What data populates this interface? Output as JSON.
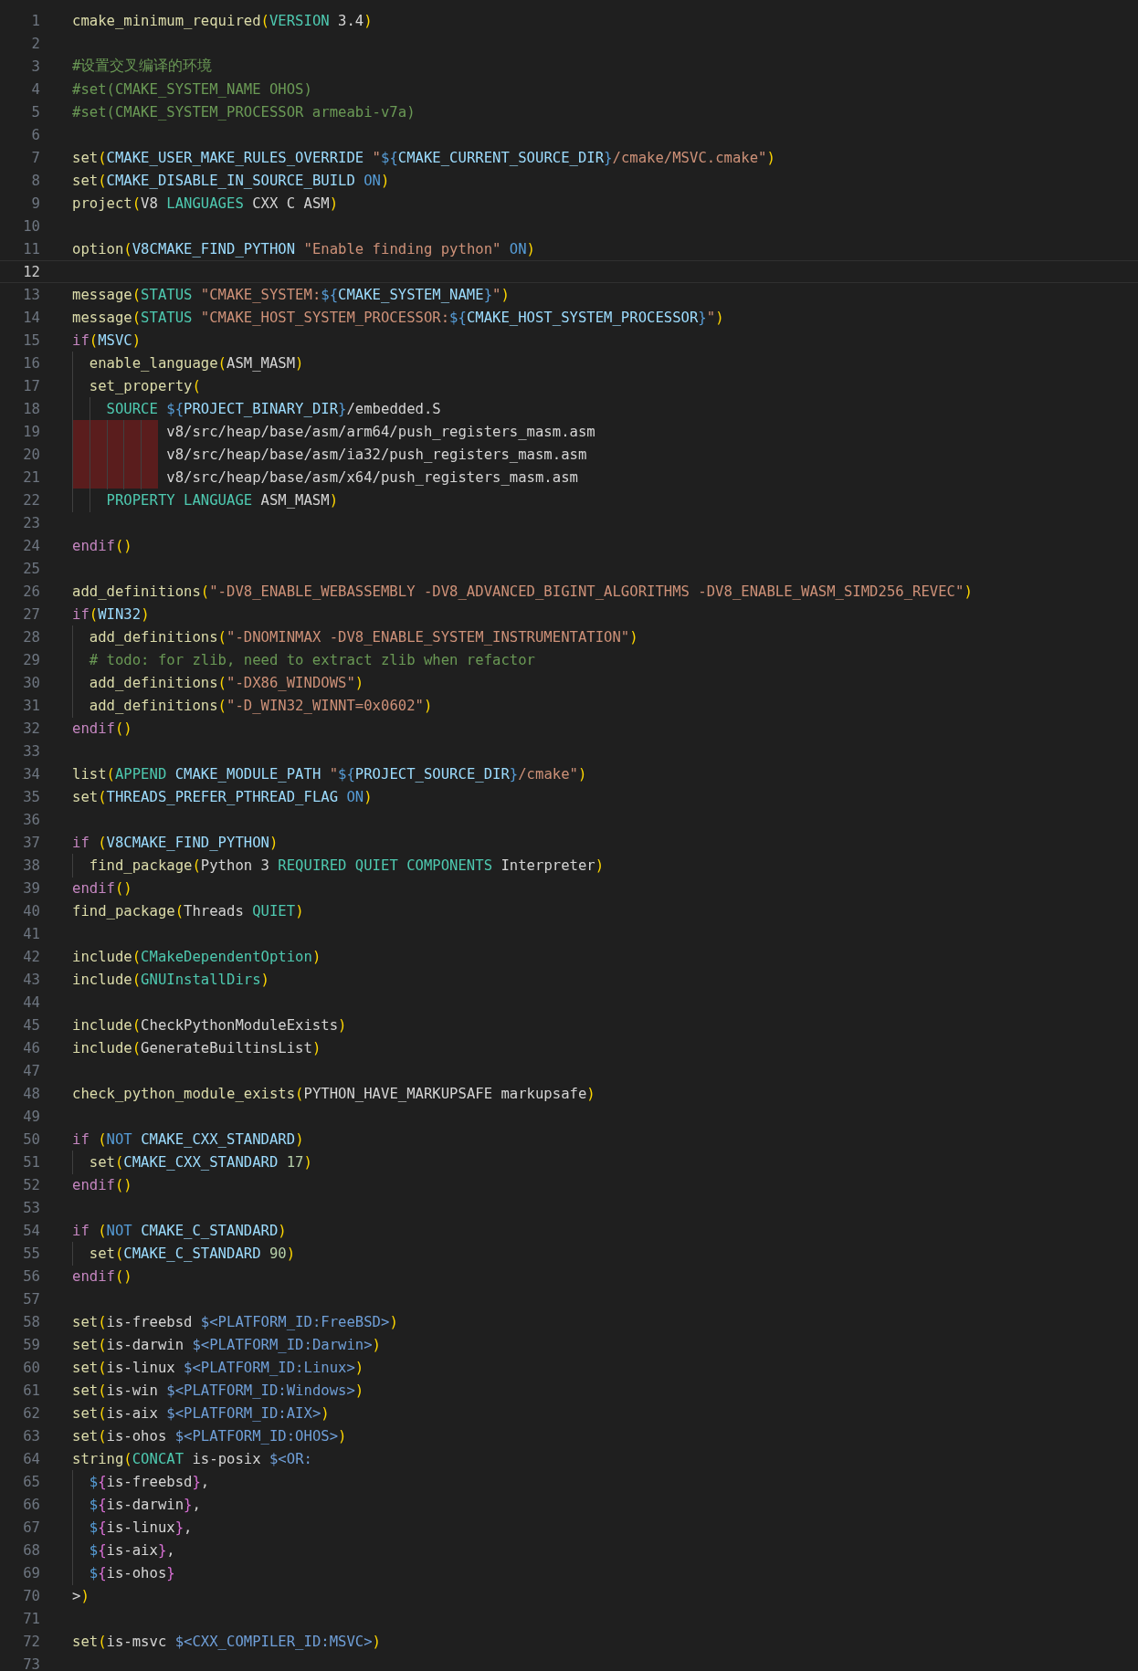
{
  "editor": {
    "lines": [
      {
        "number": "1",
        "current": false,
        "indent_error": false,
        "tokens": [
          {
            "kind": "cmd",
            "text": "cmake_minimum_required"
          },
          {
            "kind": "paren",
            "text": "("
          },
          {
            "kind": "arg",
            "text": "VERSION"
          },
          {
            "kind": "plain",
            "text": " 3.4"
          },
          {
            "kind": "paren",
            "text": ")"
          }
        ]
      },
      {
        "number": "2",
        "current": false,
        "indent_error": false
      },
      {
        "number": "3",
        "current": false,
        "indent_error": false,
        "tokens": [
          {
            "kind": "comment",
            "text": "#设置交叉编译的环境"
          }
        ]
      },
      {
        "number": "4",
        "current": false,
        "indent_error": false,
        "tokens": [
          {
            "kind": "comment",
            "text": "#set(CMAKE_SYSTEM_NAME OHOS)"
          }
        ]
      },
      {
        "number": "5",
        "current": false,
        "indent_error": false,
        "tokens": [
          {
            "kind": "comment",
            "text": "#set(CMAKE_SYSTEM_PROCESSOR armeabi-v7a)"
          }
        ]
      },
      {
        "number": "6",
        "current": false,
        "indent_error": false
      },
      {
        "number": "7",
        "current": false,
        "indent_error": false,
        "tokens": [
          {
            "kind": "cmd",
            "text": "set"
          },
          {
            "kind": "paren",
            "text": "("
          },
          {
            "kind": "var",
            "text": "CMAKE_USER_MAKE_RULES_OVERRIDE "
          },
          {
            "kind": "str",
            "text": "\""
          },
          {
            "kind": "const",
            "text": "${"
          },
          {
            "kind": "var",
            "text": "CMAKE_CURRENT_SOURCE_DIR"
          },
          {
            "kind": "const",
            "text": "}"
          },
          {
            "kind": "str",
            "text": "/cmake/MSVC.cmake\""
          },
          {
            "kind": "paren",
            "text": ")"
          }
        ]
      },
      {
        "number": "8",
        "current": false,
        "indent_error": false,
        "tokens": [
          {
            "kind": "cmd",
            "text": "set"
          },
          {
            "kind": "paren",
            "text": "("
          },
          {
            "kind": "var",
            "text": "CMAKE_DISABLE_IN_SOURCE_BUILD "
          },
          {
            "kind": "const",
            "text": "ON"
          },
          {
            "kind": "paren",
            "text": ")"
          }
        ]
      },
      {
        "number": "9",
        "current": false,
        "indent_error": false,
        "tokens": [
          {
            "kind": "cmd",
            "text": "project"
          },
          {
            "kind": "paren",
            "text": "("
          },
          {
            "kind": "plain",
            "text": "V8 "
          },
          {
            "kind": "arg",
            "text": "LANGUAGES"
          },
          {
            "kind": "plain",
            "text": " CXX C ASM"
          },
          {
            "kind": "paren",
            "text": ")"
          }
        ]
      },
      {
        "number": "10",
        "current": false,
        "indent_error": false
      },
      {
        "number": "11",
        "current": false,
        "indent_error": false,
        "tokens": [
          {
            "kind": "cmd",
            "text": "option"
          },
          {
            "kind": "paren",
            "text": "("
          },
          {
            "kind": "var",
            "text": "V8CMAKE_FIND_PYTHON "
          },
          {
            "kind": "str",
            "text": "\"Enable finding python\" "
          },
          {
            "kind": "const",
            "text": "ON"
          },
          {
            "kind": "paren",
            "text": ")"
          }
        ]
      },
      {
        "number": "12",
        "current": true,
        "indent_error": false
      },
      {
        "number": "13",
        "current": false,
        "indent_error": false,
        "tokens": [
          {
            "kind": "cmd",
            "text": "message"
          },
          {
            "kind": "paren",
            "text": "("
          },
          {
            "kind": "arg",
            "text": "STATUS "
          },
          {
            "kind": "str",
            "text": "\"CMAKE_SYSTEM:"
          },
          {
            "kind": "const",
            "text": "${"
          },
          {
            "kind": "var",
            "text": "CMAKE_SYSTEM_NAME"
          },
          {
            "kind": "const",
            "text": "}"
          },
          {
            "kind": "str",
            "text": "\""
          },
          {
            "kind": "paren",
            "text": ")"
          }
        ]
      },
      {
        "number": "14",
        "current": false,
        "indent_error": false,
        "tokens": [
          {
            "kind": "cmd",
            "text": "message"
          },
          {
            "kind": "paren",
            "text": "("
          },
          {
            "kind": "arg",
            "text": "STATUS "
          },
          {
            "kind": "str",
            "text": "\"CMAKE_HOST_SYSTEM_PROCESSOR:"
          },
          {
            "kind": "const",
            "text": "${"
          },
          {
            "kind": "var",
            "text": "CMAKE_HOST_SYSTEM_PROCESSOR"
          },
          {
            "kind": "const",
            "text": "}"
          },
          {
            "kind": "str",
            "text": "\""
          },
          {
            "kind": "paren",
            "text": ")"
          }
        ]
      },
      {
        "number": "15",
        "current": false,
        "indent_error": false,
        "tokens": [
          {
            "kind": "kw",
            "text": "if"
          },
          {
            "kind": "paren",
            "text": "("
          },
          {
            "kind": "var",
            "text": "MSVC"
          },
          {
            "kind": "paren",
            "text": ")"
          }
        ]
      },
      {
        "number": "16",
        "current": false,
        "indent_error": false,
        "tokens": [
          {
            "kind": "cmd",
            "text": "  enable_language"
          },
          {
            "kind": "paren",
            "text": "("
          },
          {
            "kind": "plain",
            "text": "ASM_MASM"
          },
          {
            "kind": "paren",
            "text": ")"
          }
        ]
      },
      {
        "number": "17",
        "current": false,
        "indent_error": false,
        "tokens": [
          {
            "kind": "cmd",
            "text": "  set_property"
          },
          {
            "kind": "paren",
            "text": "("
          }
        ]
      },
      {
        "number": "18",
        "current": false,
        "indent_error": false,
        "tokens": [
          {
            "kind": "arg",
            "text": "    SOURCE "
          },
          {
            "kind": "const",
            "text": "${"
          },
          {
            "kind": "var",
            "text": "PROJECT_BINARY_DIR"
          },
          {
            "kind": "const",
            "text": "}"
          },
          {
            "kind": "plain",
            "text": "/embedded.S"
          }
        ]
      },
      {
        "number": "19",
        "current": false,
        "indent_error": true,
        "tokens": [
          {
            "kind": "plain",
            "text": "           v8/src/heap/base/asm/arm64/push_registers_masm.asm"
          }
        ]
      },
      {
        "number": "20",
        "current": false,
        "indent_error": true,
        "tokens": [
          {
            "kind": "plain",
            "text": "           v8/src/heap/base/asm/ia32/push_registers_masm.asm"
          }
        ]
      },
      {
        "number": "21",
        "current": false,
        "indent_error": true,
        "tokens": [
          {
            "kind": "plain",
            "text": "           v8/src/heap/base/asm/x64/push_registers_masm.asm"
          }
        ]
      },
      {
        "number": "22",
        "current": false,
        "indent_error": false,
        "tokens": [
          {
            "kind": "arg",
            "text": "    PROPERTY LANGUAGE"
          },
          {
            "kind": "plain",
            "text": " ASM_MASM"
          },
          {
            "kind": "paren",
            "text": ")"
          }
        ]
      },
      {
        "number": "23",
        "current": false,
        "indent_error": false
      },
      {
        "number": "24",
        "current": false,
        "indent_error": false,
        "tokens": [
          {
            "kind": "kw",
            "text": "endif"
          },
          {
            "kind": "paren",
            "text": "()"
          }
        ]
      },
      {
        "number": "25",
        "current": false,
        "indent_error": false
      },
      {
        "number": "26",
        "current": false,
        "indent_error": false,
        "tokens": [
          {
            "kind": "cmd",
            "text": "add_definitions"
          },
          {
            "kind": "paren",
            "text": "("
          },
          {
            "kind": "str",
            "text": "\"-DV8_ENABLE_WEBASSEMBLY -DV8_ADVANCED_BIGINT_ALGORITHMS -DV8_ENABLE_WASM_SIMD256_REVEC\""
          },
          {
            "kind": "paren",
            "text": ")"
          }
        ]
      },
      {
        "number": "27",
        "current": false,
        "indent_error": false,
        "tokens": [
          {
            "kind": "kw",
            "text": "if"
          },
          {
            "kind": "paren",
            "text": "("
          },
          {
            "kind": "var",
            "text": "WIN32"
          },
          {
            "kind": "paren",
            "text": ")"
          }
        ]
      },
      {
        "number": "28",
        "current": false,
        "indent_error": false,
        "tokens": [
          {
            "kind": "cmd",
            "text": "  add_definitions"
          },
          {
            "kind": "paren",
            "text": "("
          },
          {
            "kind": "str",
            "text": "\"-DNOMINMAX -DV8_ENABLE_SYSTEM_INSTRUMENTATION\""
          },
          {
            "kind": "paren",
            "text": ")"
          }
        ]
      },
      {
        "number": "29",
        "current": false,
        "indent_error": false,
        "tokens": [
          {
            "kind": "comment",
            "text": "  # todo: for zlib, need to extract zlib when refactor"
          }
        ]
      },
      {
        "number": "30",
        "current": false,
        "indent_error": false,
        "tokens": [
          {
            "kind": "cmd",
            "text": "  add_definitions"
          },
          {
            "kind": "paren",
            "text": "("
          },
          {
            "kind": "str",
            "text": "\"-DX86_WINDOWS\""
          },
          {
            "kind": "paren",
            "text": ")"
          }
        ]
      },
      {
        "number": "31",
        "current": false,
        "indent_error": false,
        "tokens": [
          {
            "kind": "cmd",
            "text": "  add_definitions"
          },
          {
            "kind": "paren",
            "text": "("
          },
          {
            "kind": "str",
            "text": "\"-D_WIN32_WINNT=0x0602\""
          },
          {
            "kind": "paren",
            "text": ")"
          }
        ]
      },
      {
        "number": "32",
        "current": false,
        "indent_error": false,
        "tokens": [
          {
            "kind": "kw",
            "text": "endif"
          },
          {
            "kind": "paren",
            "text": "()"
          }
        ]
      },
      {
        "number": "33",
        "current": false,
        "indent_error": false
      },
      {
        "number": "34",
        "current": false,
        "indent_error": false,
        "tokens": [
          {
            "kind": "cmd",
            "text": "list"
          },
          {
            "kind": "paren",
            "text": "("
          },
          {
            "kind": "arg",
            "text": "APPEND "
          },
          {
            "kind": "var",
            "text": "CMAKE_MODULE_PATH "
          },
          {
            "kind": "str",
            "text": "\""
          },
          {
            "kind": "const",
            "text": "${"
          },
          {
            "kind": "var",
            "text": "PROJECT_SOURCE_DIR"
          },
          {
            "kind": "const",
            "text": "}"
          },
          {
            "kind": "str",
            "text": "/cmake\""
          },
          {
            "kind": "paren",
            "text": ")"
          }
        ]
      },
      {
        "number": "35",
        "current": false,
        "indent_error": false,
        "tokens": [
          {
            "kind": "cmd",
            "text": "set"
          },
          {
            "kind": "paren",
            "text": "("
          },
          {
            "kind": "var",
            "text": "THREADS_PREFER_PTHREAD_FLAG "
          },
          {
            "kind": "const",
            "text": "ON"
          },
          {
            "kind": "paren",
            "text": ")"
          }
        ]
      },
      {
        "number": "36",
        "current": false,
        "indent_error": false
      },
      {
        "number": "37",
        "current": false,
        "indent_error": false,
        "tokens": [
          {
            "kind": "kw",
            "text": "if "
          },
          {
            "kind": "paren",
            "text": "("
          },
          {
            "kind": "var",
            "text": "V8CMAKE_FIND_PYTHON"
          },
          {
            "kind": "paren",
            "text": ")"
          }
        ]
      },
      {
        "number": "38",
        "current": false,
        "indent_error": false,
        "tokens": [
          {
            "kind": "cmd",
            "text": "  find_package"
          },
          {
            "kind": "paren",
            "text": "("
          },
          {
            "kind": "plain",
            "text": "Python 3 "
          },
          {
            "kind": "arg",
            "text": "REQUIRED QUIET COMPONENTS"
          },
          {
            "kind": "plain",
            "text": " Interpreter"
          },
          {
            "kind": "paren",
            "text": ")"
          }
        ]
      },
      {
        "number": "39",
        "current": false,
        "indent_error": false,
        "tokens": [
          {
            "kind": "kw",
            "text": "endif"
          },
          {
            "kind": "paren",
            "text": "()"
          }
        ]
      },
      {
        "number": "40",
        "current": false,
        "indent_error": false,
        "tokens": [
          {
            "kind": "cmd",
            "text": "find_package"
          },
          {
            "kind": "paren",
            "text": "("
          },
          {
            "kind": "plain",
            "text": "Threads "
          },
          {
            "kind": "arg",
            "text": "QUIET"
          },
          {
            "kind": "paren",
            "text": ")"
          }
        ]
      },
      {
        "number": "41",
        "current": false,
        "indent_error": false
      },
      {
        "number": "42",
        "current": false,
        "indent_error": false,
        "tokens": [
          {
            "kind": "cmd",
            "text": "include"
          },
          {
            "kind": "paren",
            "text": "("
          },
          {
            "kind": "arg",
            "text": "CMakeDependentOption"
          },
          {
            "kind": "paren",
            "text": ")"
          }
        ]
      },
      {
        "number": "43",
        "current": false,
        "indent_error": false,
        "tokens": [
          {
            "kind": "cmd",
            "text": "include"
          },
          {
            "kind": "paren",
            "text": "("
          },
          {
            "kind": "arg",
            "text": "GNUInstallDirs"
          },
          {
            "kind": "paren",
            "text": ")"
          }
        ]
      },
      {
        "number": "44",
        "current": false,
        "indent_error": false
      },
      {
        "number": "45",
        "current": false,
        "indent_error": false,
        "tokens": [
          {
            "kind": "cmd",
            "text": "include"
          },
          {
            "kind": "paren",
            "text": "("
          },
          {
            "kind": "plain",
            "text": "CheckPythonModuleExists"
          },
          {
            "kind": "paren",
            "text": ")"
          }
        ]
      },
      {
        "number": "46",
        "current": false,
        "indent_error": false,
        "tokens": [
          {
            "kind": "cmd",
            "text": "include"
          },
          {
            "kind": "paren",
            "text": "("
          },
          {
            "kind": "plain",
            "text": "GenerateBuiltinsList"
          },
          {
            "kind": "paren",
            "text": ")"
          }
        ]
      },
      {
        "number": "47",
        "current": false,
        "indent_error": false
      },
      {
        "number": "48",
        "current": false,
        "indent_error": false,
        "tokens": [
          {
            "kind": "cmd",
            "text": "check_python_module_exists"
          },
          {
            "kind": "paren",
            "text": "("
          },
          {
            "kind": "plain",
            "text": "PYTHON_HAVE_MARKUPSAFE markupsafe"
          },
          {
            "kind": "paren",
            "text": ")"
          }
        ]
      },
      {
        "number": "49",
        "current": false,
        "indent_error": false
      },
      {
        "number": "50",
        "current": false,
        "indent_error": false,
        "tokens": [
          {
            "kind": "kw",
            "text": "if "
          },
          {
            "kind": "paren",
            "text": "("
          },
          {
            "kind": "const",
            "text": "NOT "
          },
          {
            "kind": "var",
            "text": "CMAKE_CXX_STANDARD"
          },
          {
            "kind": "paren",
            "text": ")"
          }
        ]
      },
      {
        "number": "51",
        "current": false,
        "indent_error": false,
        "tokens": [
          {
            "kind": "cmd",
            "text": "  set"
          },
          {
            "kind": "paren",
            "text": "("
          },
          {
            "kind": "var",
            "text": "CMAKE_CXX_STANDARD "
          },
          {
            "kind": "num",
            "text": "17"
          },
          {
            "kind": "paren",
            "text": ")"
          }
        ]
      },
      {
        "number": "52",
        "current": false,
        "indent_error": false,
        "tokens": [
          {
            "kind": "kw",
            "text": "endif"
          },
          {
            "kind": "paren",
            "text": "()"
          }
        ]
      },
      {
        "number": "53",
        "current": false,
        "indent_error": false
      },
      {
        "number": "54",
        "current": false,
        "indent_error": false,
        "tokens": [
          {
            "kind": "kw",
            "text": "if "
          },
          {
            "kind": "paren",
            "text": "("
          },
          {
            "kind": "const",
            "text": "NOT "
          },
          {
            "kind": "var",
            "text": "CMAKE_C_STANDARD"
          },
          {
            "kind": "paren",
            "text": ")"
          }
        ]
      },
      {
        "number": "55",
        "current": false,
        "indent_error": false,
        "tokens": [
          {
            "kind": "cmd",
            "text": "  set"
          },
          {
            "kind": "paren",
            "text": "("
          },
          {
            "kind": "var",
            "text": "CMAKE_C_STANDARD "
          },
          {
            "kind": "num",
            "text": "90"
          },
          {
            "kind": "paren",
            "text": ")"
          }
        ]
      },
      {
        "number": "56",
        "current": false,
        "indent_error": false,
        "tokens": [
          {
            "kind": "kw",
            "text": "endif"
          },
          {
            "kind": "paren",
            "text": "()"
          }
        ]
      },
      {
        "number": "57",
        "current": false,
        "indent_error": false
      },
      {
        "number": "58",
        "current": false,
        "indent_error": false,
        "tokens": [
          {
            "kind": "cmd",
            "text": "set"
          },
          {
            "kind": "paren",
            "text": "("
          },
          {
            "kind": "plain",
            "text": "is-freebsd "
          },
          {
            "kind": "gen",
            "text": "$<PLATFORM_ID:FreeBSD>"
          },
          {
            "kind": "paren",
            "text": ")"
          }
        ]
      },
      {
        "number": "59",
        "current": false,
        "indent_error": false,
        "tokens": [
          {
            "kind": "cmd",
            "text": "set"
          },
          {
            "kind": "paren",
            "text": "("
          },
          {
            "kind": "plain",
            "text": "is-darwin "
          },
          {
            "kind": "gen",
            "text": "$<PLATFORM_ID:Darwin>"
          },
          {
            "kind": "paren",
            "text": ")"
          }
        ]
      },
      {
        "number": "60",
        "current": false,
        "indent_error": false,
        "tokens": [
          {
            "kind": "cmd",
            "text": "set"
          },
          {
            "kind": "paren",
            "text": "("
          },
          {
            "kind": "plain",
            "text": "is-linux "
          },
          {
            "kind": "gen",
            "text": "$<PLATFORM_ID:Linux>"
          },
          {
            "kind": "paren",
            "text": ")"
          }
        ]
      },
      {
        "number": "61",
        "current": false,
        "indent_error": false,
        "tokens": [
          {
            "kind": "cmd",
            "text": "set"
          },
          {
            "kind": "paren",
            "text": "("
          },
          {
            "kind": "plain",
            "text": "is-win "
          },
          {
            "kind": "gen",
            "text": "$<PLATFORM_ID:Windows>"
          },
          {
            "kind": "paren",
            "text": ")"
          }
        ]
      },
      {
        "number": "62",
        "current": false,
        "indent_error": false,
        "tokens": [
          {
            "kind": "cmd",
            "text": "set"
          },
          {
            "kind": "paren",
            "text": "("
          },
          {
            "kind": "plain",
            "text": "is-aix "
          },
          {
            "kind": "gen",
            "text": "$<PLATFORM_ID:AIX>"
          },
          {
            "kind": "paren",
            "text": ")"
          }
        ]
      },
      {
        "number": "63",
        "current": false,
        "indent_error": false,
        "tokens": [
          {
            "kind": "cmd",
            "text": "set"
          },
          {
            "kind": "paren",
            "text": "("
          },
          {
            "kind": "plain",
            "text": "is-ohos "
          },
          {
            "kind": "gen",
            "text": "$<PLATFORM_ID:OHOS>"
          },
          {
            "kind": "paren",
            "text": ")"
          }
        ]
      },
      {
        "number": "64",
        "current": false,
        "indent_error": false,
        "tokens": [
          {
            "kind": "cmd",
            "text": "string"
          },
          {
            "kind": "paren",
            "text": "("
          },
          {
            "kind": "arg",
            "text": "CONCAT"
          },
          {
            "kind": "plain",
            "text": " is-posix "
          },
          {
            "kind": "gen",
            "text": "$<OR:"
          }
        ]
      },
      {
        "number": "65",
        "current": false,
        "indent_error": false,
        "tokens": [
          {
            "kind": "const",
            "text": "  $"
          },
          {
            "kind": "brace",
            "text": "{"
          },
          {
            "kind": "plain",
            "text": "is-freebsd"
          },
          {
            "kind": "brace",
            "text": "}"
          },
          {
            "kind": "plain",
            "text": ","
          }
        ]
      },
      {
        "number": "66",
        "current": false,
        "indent_error": false,
        "tokens": [
          {
            "kind": "const",
            "text": "  $"
          },
          {
            "kind": "brace",
            "text": "{"
          },
          {
            "kind": "plain",
            "text": "is-darwin"
          },
          {
            "kind": "brace",
            "text": "}"
          },
          {
            "kind": "plain",
            "text": ","
          }
        ]
      },
      {
        "number": "67",
        "current": false,
        "indent_error": false,
        "tokens": [
          {
            "kind": "const",
            "text": "  $"
          },
          {
            "kind": "brace",
            "text": "{"
          },
          {
            "kind": "plain",
            "text": "is-linux"
          },
          {
            "kind": "brace",
            "text": "}"
          },
          {
            "kind": "plain",
            "text": ","
          }
        ]
      },
      {
        "number": "68",
        "current": false,
        "indent_error": false,
        "tokens": [
          {
            "kind": "const",
            "text": "  $"
          },
          {
            "kind": "brace",
            "text": "{"
          },
          {
            "kind": "plain",
            "text": "is-aix"
          },
          {
            "kind": "brace",
            "text": "}"
          },
          {
            "kind": "plain",
            "text": ","
          }
        ]
      },
      {
        "number": "69",
        "current": false,
        "indent_error": false,
        "tokens": [
          {
            "kind": "const",
            "text": "  $"
          },
          {
            "kind": "brace",
            "text": "{"
          },
          {
            "kind": "plain",
            "text": "is-ohos"
          },
          {
            "kind": "brace",
            "text": "}"
          }
        ]
      },
      {
        "number": "70",
        "current": false,
        "indent_error": false,
        "tokens": [
          {
            "kind": "plain",
            "text": ">"
          },
          {
            "kind": "paren",
            "text": ")"
          }
        ]
      },
      {
        "number": "71",
        "current": false,
        "indent_error": false
      },
      {
        "number": "72",
        "current": false,
        "indent_error": false,
        "tokens": [
          {
            "kind": "cmd",
            "text": "set"
          },
          {
            "kind": "paren",
            "text": "("
          },
          {
            "kind": "plain",
            "text": "is-msvc "
          },
          {
            "kind": "gen",
            "text": "$<CXX_COMPILER_ID:MSVC>"
          },
          {
            "kind": "paren",
            "text": ")"
          }
        ]
      },
      {
        "number": "73",
        "current": false,
        "indent_error": false
      }
    ]
  }
}
